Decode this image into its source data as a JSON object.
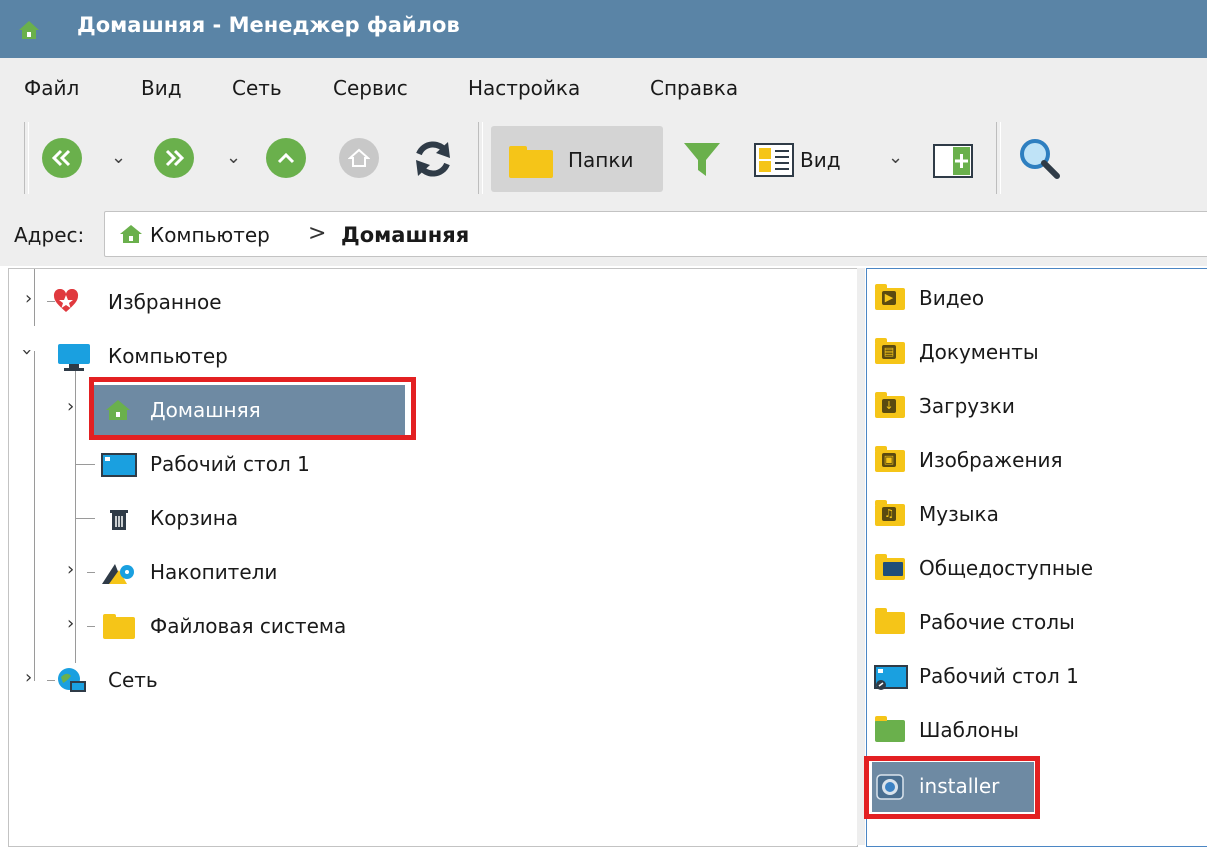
{
  "window": {
    "title": "Домашняя - Менеджер файлов"
  },
  "menu": [
    "Файл",
    "Вид",
    "Сеть",
    "Сервис",
    "Настройка",
    "Справка"
  ],
  "toolbar": {
    "folders_label": "Папки",
    "view_label": "Вид",
    "accent": "#6ab04c"
  },
  "address": {
    "label": "Адрес:",
    "crumbs": [
      "Компьютер",
      "Домашняя"
    ],
    "separator": ">"
  },
  "tree": {
    "items": [
      {
        "label": "Избранное",
        "icon": "favorites-icon"
      },
      {
        "label": "Компьютер",
        "icon": "computer-icon"
      },
      {
        "label": "Домашняя",
        "icon": "home-icon",
        "selected": true
      },
      {
        "label": "Рабочий стол 1",
        "icon": "desktop-icon"
      },
      {
        "label": "Корзина",
        "icon": "trash-icon"
      },
      {
        "label": "Накопители",
        "icon": "drives-icon"
      },
      {
        "label": "Файловая система",
        "icon": "folder-icon"
      },
      {
        "label": "Сеть",
        "icon": "network-icon"
      }
    ]
  },
  "files": {
    "items": [
      {
        "label": "Видео",
        "icon": "video-folder-icon"
      },
      {
        "label": "Документы",
        "icon": "documents-folder-icon"
      },
      {
        "label": "Загрузки",
        "icon": "downloads-folder-icon"
      },
      {
        "label": "Изображения",
        "icon": "images-folder-icon"
      },
      {
        "label": "Музыка",
        "icon": "music-folder-icon"
      },
      {
        "label": "Общедоступные",
        "icon": "public-folder-icon"
      },
      {
        "label": "Рабочие столы",
        "icon": "folder-icon"
      },
      {
        "label": "Рабочий стол 1",
        "icon": "desktop-link-icon"
      },
      {
        "label": "Шаблоны",
        "icon": "templates-folder-icon"
      },
      {
        "label": "installer",
        "icon": "installer-icon",
        "selected": true
      }
    ]
  },
  "colors": {
    "titlebar": "#5a84a6",
    "selection": "#6e8aa3",
    "highlight_box": "#e32022"
  }
}
